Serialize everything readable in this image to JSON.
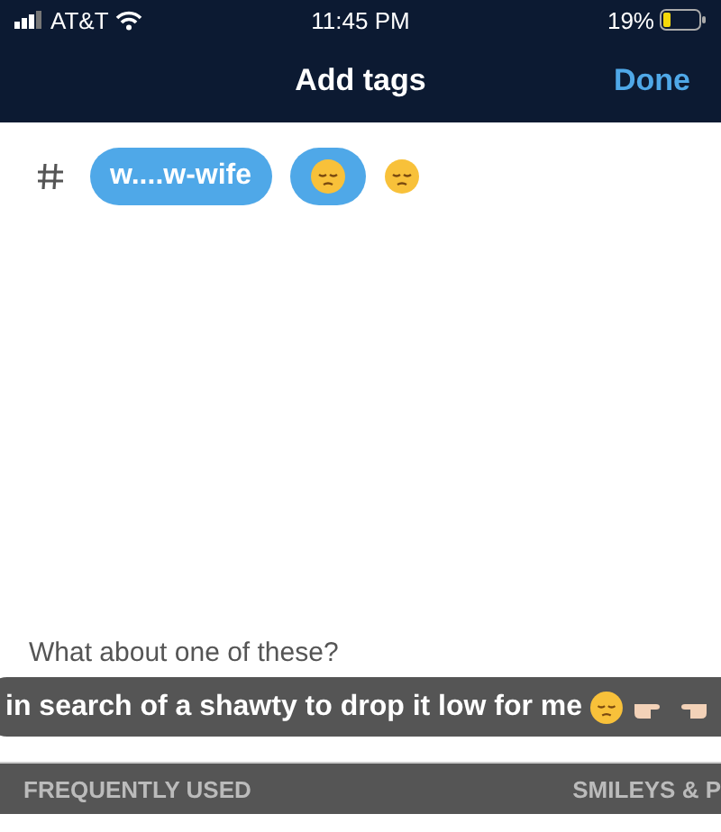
{
  "status_bar": {
    "carrier": "AT&T",
    "time": "11:45 PM",
    "battery": "19%"
  },
  "header": {
    "title": "Add tags",
    "done": "Done"
  },
  "tags": [
    {
      "kind": "text",
      "label": "w....w-wife"
    },
    {
      "kind": "emoji"
    }
  ],
  "typed": {
    "kind": "emoji"
  },
  "suggestions": {
    "heading": "What about one of these?",
    "items": [
      {
        "label": "in search of a shawty to drop it low for me"
      }
    ]
  },
  "keyboard": {
    "categories": [
      "FREQUENTLY USED",
      "SMILEYS & P"
    ]
  }
}
